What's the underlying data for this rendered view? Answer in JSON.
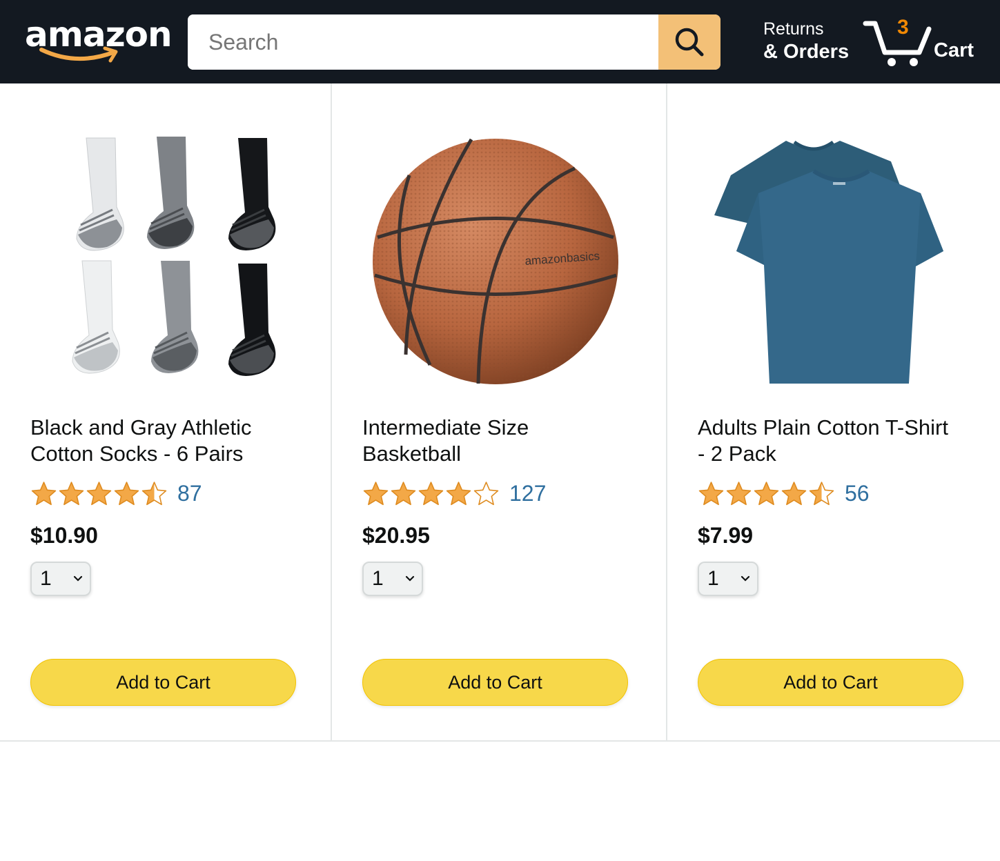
{
  "header": {
    "logo_text": "amazon",
    "search": {
      "placeholder": "Search",
      "value": ""
    },
    "returns_line1": "Returns",
    "returns_line2": "& Orders",
    "cart_count": "3",
    "cart_label": "Cart"
  },
  "colors": {
    "header_bg": "#131921",
    "search_button": "#f3c077",
    "cart_count": "#f08804",
    "star": "#f3a847",
    "link": "#2f6f9f",
    "add_button": "#f7d84a"
  },
  "products": [
    {
      "name": "Black and Gray Athletic Cotton Socks - 6 Pairs",
      "image": "socks-image",
      "rating_stars": 4.5,
      "rating_count": "87",
      "price": "$10.90",
      "quantity": "1",
      "button_label": "Add to Cart"
    },
    {
      "name": "Intermediate Size Basketball",
      "image": "basketball-image",
      "image_text": "amazonbasics",
      "rating_stars": 4,
      "rating_count": "127",
      "price": "$20.95",
      "quantity": "1",
      "button_label": "Add to Cart"
    },
    {
      "name": "Adults Plain Cotton T-Shirt - 2 Pack",
      "image": "tshirt-image",
      "rating_stars": 4.5,
      "rating_count": "56",
      "price": "$7.99",
      "quantity": "1",
      "button_label": "Add to Cart"
    }
  ]
}
